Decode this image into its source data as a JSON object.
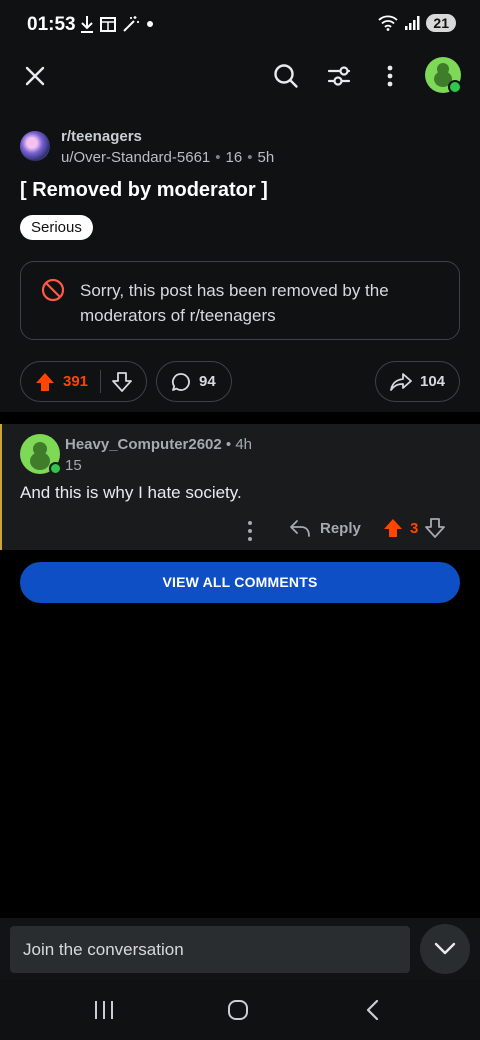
{
  "status_bar": {
    "time": "01:53",
    "battery": "21",
    "left_icons": [
      "download-icon",
      "screen-icon",
      "magic-wand-icon",
      "dot-icon"
    ],
    "right_icons": [
      "wifi-icon",
      "signal-icon",
      "battery-icon"
    ]
  },
  "top_bar": {
    "icons": [
      "close-icon",
      "search-icon",
      "sort-icon",
      "more-vertical-icon",
      "avatar"
    ]
  },
  "post": {
    "subreddit": "r/teenagers",
    "author": "u/Over-Standard-5661",
    "karma": "16",
    "age": "5h",
    "title": "[ Removed by moderator ]",
    "flair": "Serious",
    "removed_notice": "Sorry, this post has been removed by the moderators of r/teenagers",
    "upvotes": "391",
    "comments": "94",
    "shares": "104"
  },
  "comment": {
    "username": "Heavy_Computer2602",
    "age": "4h",
    "score_line": "15",
    "body": "And this is why I hate society.",
    "reply_label": "Reply",
    "votes": "3"
  },
  "view_all_label": "VIEW ALL COMMENTS",
  "composer": {
    "placeholder": "Join the conversation"
  },
  "colors": {
    "upvote": "#ff4500",
    "primary_button": "#0e4fc6",
    "online": "#2ec84d",
    "avatar_green": "#7ed957",
    "thread_line": "#c9a53a"
  }
}
